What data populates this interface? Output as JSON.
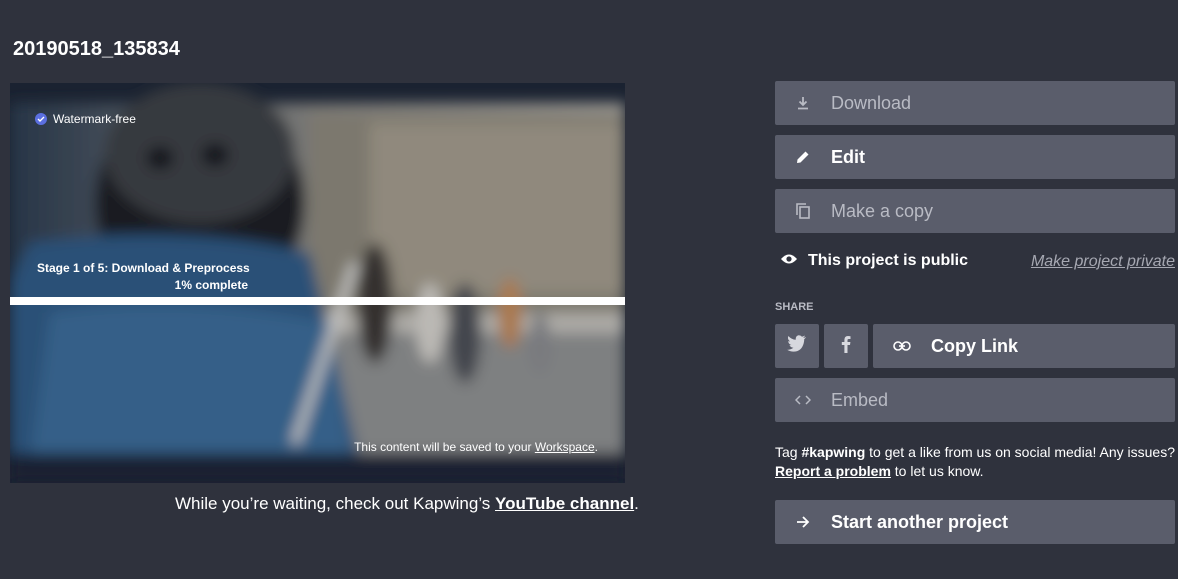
{
  "project": {
    "title": "20190518_135834"
  },
  "preview": {
    "watermark_label": "Watermark-free",
    "stage_label": "Stage 1 of 5: Download & Preprocess",
    "percent_label": "1% complete",
    "progress_fraction": 0.01,
    "saved_prefix": "This content will be saved to your ",
    "saved_link": "Workspace",
    "saved_suffix": "."
  },
  "waiting": {
    "prefix": "While you’re waiting, check out Kapwing’s ",
    "link": "YouTube channel",
    "suffix": "."
  },
  "actions": {
    "download": "Download",
    "edit": "Edit",
    "copy": "Make a copy",
    "public_status": "This project is public",
    "make_private": "Make project private",
    "share_label": "SHARE",
    "copy_link": "Copy Link",
    "embed": "Embed",
    "start_another": "Start another project"
  },
  "social": {
    "tag_prefix": "Tag ",
    "hashtag": "#kapwing",
    "tag_middle": " to get a like from us on social media! Any issues? ",
    "report_link": "Report a problem",
    "tag_suffix": " to let us know."
  },
  "icons": {
    "download": "download-icon",
    "edit": "pencil-icon",
    "copy": "copy-icon",
    "eye": "eye-icon",
    "twitter": "twitter-icon",
    "facebook": "facebook-icon",
    "link": "link-icon",
    "embed": "code-icon",
    "arrow": "arrow-right-icon",
    "check": "check-circle-icon"
  },
  "colors": {
    "background": "#2f323d",
    "button": "#5a5d6b",
    "accent": "#5b6fe0"
  }
}
